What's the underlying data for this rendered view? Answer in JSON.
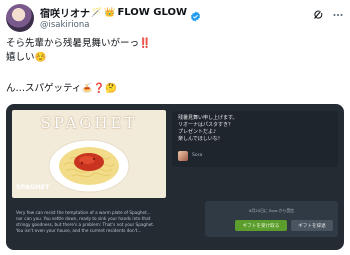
{
  "tweet": {
    "display_name": "宿咲リオナ",
    "name_emoji": "🪄",
    "crown_emoji": "👑",
    "flow_label": "FLOW GLOW",
    "handle": "@isakiriona",
    "text_line1": "そら先輩から残暑見舞いがーっ‼️",
    "text_line2": "嬉しい☺️",
    "text_line3": "ん…スパゲッティ🍝❓🤔"
  },
  "card": {
    "art_title": "SPAGHET",
    "game_title": "SPAGHET",
    "description_lines": [
      "Very few can resist the temptation of a warm plate of Spaghet...",
      "nor can you. You settle down, ready to sink your hands into that",
      "stringy goodness, but there's a problem: That's not your Spaghet.",
      "You isn't even your house, and the current residents don't..."
    ],
    "gift_message": [
      "残暑見舞い申し上げます。",
      "リオーナはパスタすき？",
      "プレゼントだよ♪",
      "楽しんでほしいな！"
    ],
    "sender_name": "Sora",
    "gift_note": "8月20日に Sora から受信",
    "accept_label": "ギフトを受け取る",
    "decline_label": "ギフトを辞退"
  },
  "colors": {
    "card_bg": "#242b33",
    "accept_green": "#5c9e2d",
    "verified_blue": "#1d9bf0"
  },
  "icons": [
    "verified-badge-icon",
    "grok-icon",
    "more-options-icon"
  ]
}
